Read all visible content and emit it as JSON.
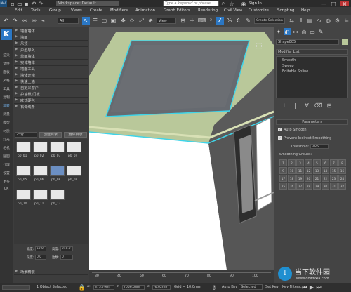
{
  "title_bar": {
    "workspace": "Workspace: Default",
    "search_placeholder": "Type a keyword or phrase",
    "sign_in": "Sign In",
    "app_badge": "MAX"
  },
  "menu": [
    "Edit",
    "Tools",
    "Group",
    "Views",
    "Create",
    "Modifiers",
    "Animation",
    "Graph Editors",
    "Rendering",
    "Civil View",
    "Customize",
    "Scripting",
    "Help"
  ],
  "toolbar": {
    "filter": "All",
    "view": "View",
    "selection_set": "Create Selection Se"
  },
  "strip_items": [
    "K",
    "渲染",
    "文件",
    "面板",
    "风格",
    "工具",
    "复制",
    "旋转",
    "测量",
    "模型",
    "材质",
    "灯光",
    "相机",
    "贴图",
    "代理",
    "设置",
    "更多",
    "CK"
  ],
  "plugin": {
    "categories": [
      "墙面墙体",
      "墙面",
      "吊顶",
      "户型导入",
      "单面墙体",
      "实体墙体",
      "墙面工具",
      "墙体开槽",
      "快速上墙",
      "自定义窗户",
      "护墙板/门板",
      "欧式硬包",
      "石膏线条"
    ],
    "tabs": [
      "石膏",
      "创建目录",
      "删除目录"
    ],
    "tiles": [
      "p0_01",
      "p0_02",
      "p0_03",
      "p0_04",
      "p0_05",
      "p0_06",
      "p0_08",
      "p0_09",
      "p0_10",
      "p0_11",
      "p0_12"
    ],
    "param_labels": [
      "宽度:",
      "高度:",
      "深度:",
      "边数:"
    ],
    "param_values": [
      "50.0",
      "240.0",
      "0.0",
      "0"
    ],
    "bottom_label": "场景精装"
  },
  "rpanel": {
    "object_name": "Shape005",
    "modifier_list": "Modifier List",
    "stack": [
      "Smooth",
      "Sweep",
      "Editable Spline"
    ],
    "rollout": "Parameters",
    "auto_smooth": "Auto Smooth",
    "prevent": "Prevent Indirect Smoothing",
    "threshold_label": "Threshold:",
    "threshold": "30.0",
    "groups_label": "Smoothing Groups:",
    "groups": [
      "1",
      "2",
      "3",
      "4",
      "5",
      "6",
      "7",
      "8",
      "9",
      "10",
      "11",
      "12",
      "13",
      "14",
      "15",
      "16",
      "17",
      "18",
      "19",
      "20",
      "21",
      "22",
      "23",
      "24",
      "25",
      "26",
      "27",
      "28",
      "29",
      "30",
      "31",
      "32"
    ]
  },
  "timeline": {
    "ticks": [
      "30",
      "40",
      "50",
      "60",
      "70",
      "80",
      "90",
      "100"
    ]
  },
  "status": {
    "selected": "1 Object Selected",
    "x": "375.79m",
    "y": "7056.58m",
    "z": "-6.02mm",
    "grid": "Grid = 10.0mm",
    "autokey": "Auto Key",
    "selected_dd": "Selected",
    "setkey": "Set Key",
    "key_filters": "Key Filters...",
    "watermark": "当下软件园",
    "watermark_url": "www.downxia.com"
  },
  "colors": {
    "accent_blue": "#2b77c4",
    "ceiling_green": "#b9c89a",
    "cyan_outline": "#3fd4e8",
    "selected_tile": "#6c8fc2"
  }
}
